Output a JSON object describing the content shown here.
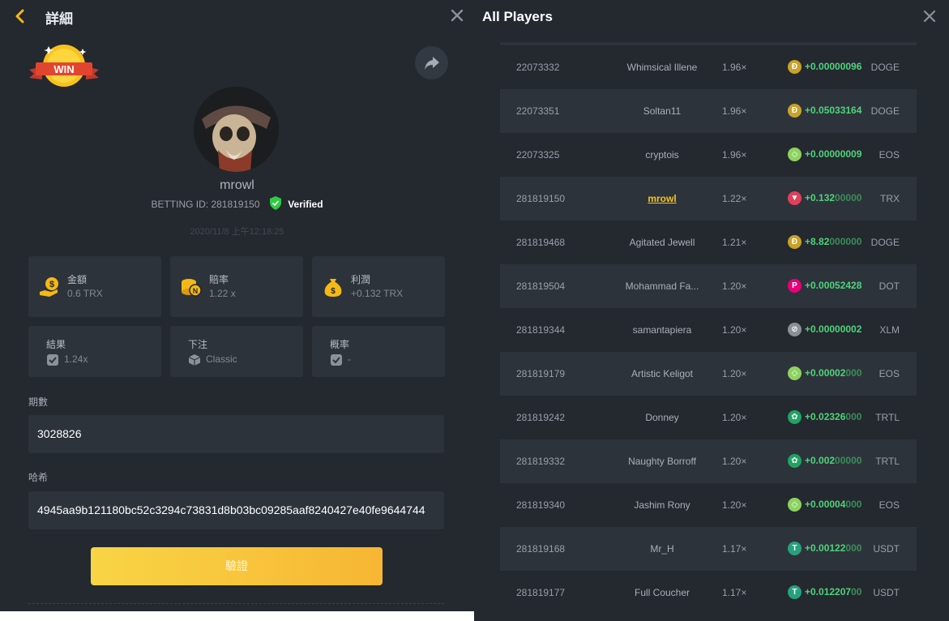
{
  "left": {
    "title": "詳細",
    "win_badge_text": "WIN",
    "username": "mrowl",
    "betting_id_label": "BETTING ID: 281819150",
    "verified_label": "Verified",
    "datetime": "2020/11/8 上午12:18:25",
    "cards": [
      {
        "label": "金額",
        "value": "0.6 TRX",
        "icon": "coin-hand-icon"
      },
      {
        "label": "賠率",
        "value": "1.22 x",
        "icon": "coin-stack-icon"
      },
      {
        "label": "利潤",
        "value": "+0.132 TRX",
        "icon": "money-bag-icon"
      }
    ],
    "small_cards": [
      {
        "label": "結果",
        "value": "1.24x",
        "icon": "check-dice-icon"
      },
      {
        "label": "下注",
        "value": "Classic",
        "icon": "cube-icon"
      },
      {
        "label": "概率",
        "value": "-",
        "icon": "check-dice-icon"
      }
    ],
    "period_label": "期數",
    "period_value": "3028826",
    "hash_label": "哈希",
    "hash_value": "4945aa9b121180bc52c3294c73831d8b03bc09285aaf8240427e40fe9644744",
    "verify_button": "驗證"
  },
  "right": {
    "title": "All Players",
    "rows": [
      {
        "id": "22073332",
        "name": "Whimsical Illene",
        "mult": "1.96×",
        "coin": "doge",
        "profit_bright": "+0.00000096",
        "profit_dim": "",
        "currency": "DOGE"
      },
      {
        "id": "22073351",
        "name": "Soltan11",
        "mult": "1.96×",
        "coin": "doge",
        "profit_bright": "+0.05033164",
        "profit_dim": "",
        "currency": "DOGE"
      },
      {
        "id": "22073325",
        "name": "cryptois",
        "mult": "1.96×",
        "coin": "eos",
        "profit_bright": "+0.00000009",
        "profit_dim": "",
        "currency": "EOS"
      },
      {
        "id": "281819150",
        "name": "mrowl",
        "mult": "1.22×",
        "coin": "trx",
        "profit_bright": "+0.132",
        "profit_dim": "00000",
        "currency": "TRX",
        "me": true
      },
      {
        "id": "281819468",
        "name": "Agitated Jewell",
        "mult": "1.21×",
        "coin": "doge",
        "profit_bright": "+8.82",
        "profit_dim": "000000",
        "currency": "DOGE"
      },
      {
        "id": "281819504",
        "name": "Mohammad Fa...",
        "mult": "1.20×",
        "coin": "dot",
        "profit_bright": "+0.00052428",
        "profit_dim": "",
        "currency": "DOT"
      },
      {
        "id": "281819344",
        "name": "samantapiera",
        "mult": "1.20×",
        "coin": "xlm",
        "profit_bright": "+0.00000002",
        "profit_dim": "",
        "currency": "XLM"
      },
      {
        "id": "281819179",
        "name": "Artistic Keligot",
        "mult": "1.20×",
        "coin": "eos",
        "profit_bright": "+0.00002",
        "profit_dim": "000",
        "currency": "EOS"
      },
      {
        "id": "281819242",
        "name": "Donney",
        "mult": "1.20×",
        "coin": "trtl",
        "profit_bright": "+0.02326",
        "profit_dim": "000",
        "currency": "TRTL"
      },
      {
        "id": "281819332",
        "name": "Naughty Borroff",
        "mult": "1.20×",
        "coin": "trtl",
        "profit_bright": "+0.002",
        "profit_dim": "00000",
        "currency": "TRTL"
      },
      {
        "id": "281819340",
        "name": "Jashim Rony",
        "mult": "1.20×",
        "coin": "eos",
        "profit_bright": "+0.00004",
        "profit_dim": "000",
        "currency": "EOS"
      },
      {
        "id": "281819168",
        "name": "Mr_H",
        "mult": "1.17×",
        "coin": "usdt",
        "profit_bright": "+0.00122",
        "profit_dim": "000",
        "currency": "USDT"
      },
      {
        "id": "281819177",
        "name": "Full Coucher",
        "mult": "1.17×",
        "coin": "usdt",
        "profit_bright": "+0.012207",
        "profit_dim": "00",
        "currency": "USDT"
      }
    ]
  },
  "coins": {
    "doge": {
      "color": "#c9a227",
      "glyph": "Ð"
    },
    "eos": {
      "color": "#8dd35f",
      "glyph": "◇"
    },
    "trx": {
      "color": "#e0405a",
      "glyph": "▼"
    },
    "dot": {
      "color": "#e6007a",
      "glyph": "P"
    },
    "xlm": {
      "color": "#8b8f96",
      "glyph": "⊘"
    },
    "trtl": {
      "color": "#1fa463",
      "glyph": "✿"
    },
    "usdt": {
      "color": "#26a17b",
      "glyph": "T"
    }
  },
  "colors": {
    "accent": "#f5b914",
    "panel": "#24282f",
    "card": "#2d333b",
    "profit": "#4fd47b",
    "verified": "#2ecc40"
  }
}
